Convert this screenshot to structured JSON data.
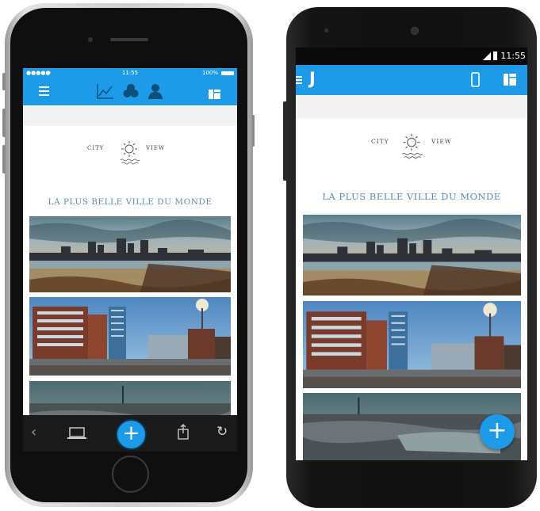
{
  "iphone": {
    "status": {
      "carrier": "●●●●● ",
      "time": "11:55",
      "battery": "100%"
    },
    "nav_icons": [
      "menu-icon",
      "chart-icon",
      "circles-icon",
      "person-icon",
      "layout-icon"
    ],
    "logo": {
      "left": "CITY",
      "right": "VIEW"
    },
    "tagline": "LA PLUS BELLE VILLE DU MONDE",
    "toolbar_icons": [
      "back-icon",
      "laptop-icon",
      "add-icon",
      "share-icon",
      "refresh-icon"
    ]
  },
  "android": {
    "status": {
      "time": "11:55"
    },
    "app_letter": "J",
    "logo": {
      "left": "CITY",
      "right": "VIEW"
    },
    "tagline": "LA PLUS BELLE VILLE DU MONDE",
    "fab_label": "+"
  },
  "colors": {
    "accent": "#1d9be9",
    "tagline": "#5f8ca6"
  }
}
